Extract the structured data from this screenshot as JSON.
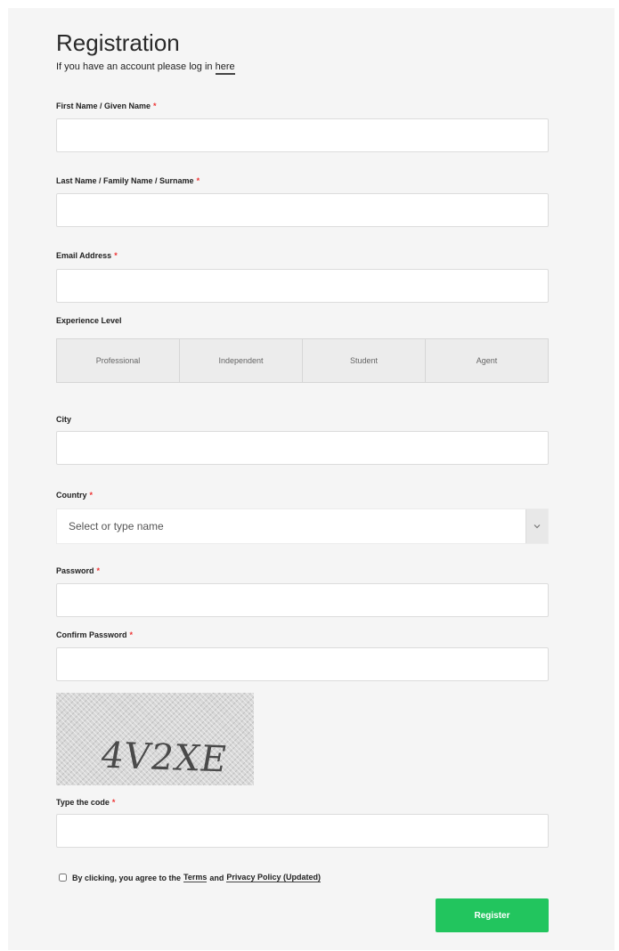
{
  "header": {
    "title": "Registration",
    "subtitle_prefix": "If you have an account please log in",
    "login_link": "here"
  },
  "fields": {
    "first_name": {
      "label": "First Name / Given Name",
      "required_mark": "*",
      "value": ""
    },
    "last_name": {
      "label": "Last Name / Family Name / Surname",
      "required_mark": "*",
      "value": ""
    },
    "email": {
      "label": "Email Address",
      "required_mark": "*",
      "value": ""
    },
    "city": {
      "label": "City",
      "value": ""
    },
    "password": {
      "label": "Password",
      "required_mark": "*",
      "value": ""
    },
    "confirm_password": {
      "label": "Confirm Password",
      "required_mark": "*",
      "value": ""
    },
    "captcha_code": {
      "label": "Type the code",
      "required_mark": "*",
      "value": ""
    }
  },
  "experience": {
    "label": "Experience Level",
    "options": [
      "Professional",
      "Independent",
      "Student",
      "Agent"
    ]
  },
  "country": {
    "label": "Country",
    "required_mark": "*",
    "placeholder": "Select or type name",
    "caret_icon": "chevron-down-icon"
  },
  "captcha": {
    "text": "4V2XE"
  },
  "agreement": {
    "prefix": "By clicking, you agree to the",
    "terms_link": "Terms",
    "and": "and",
    "privacy_link": "Privacy Policy (Updated)",
    "checked": false
  },
  "actions": {
    "register_label": "Register"
  },
  "colors": {
    "accent": "#22c55e",
    "required": "#e33333",
    "panel": "#f5f5f5"
  }
}
